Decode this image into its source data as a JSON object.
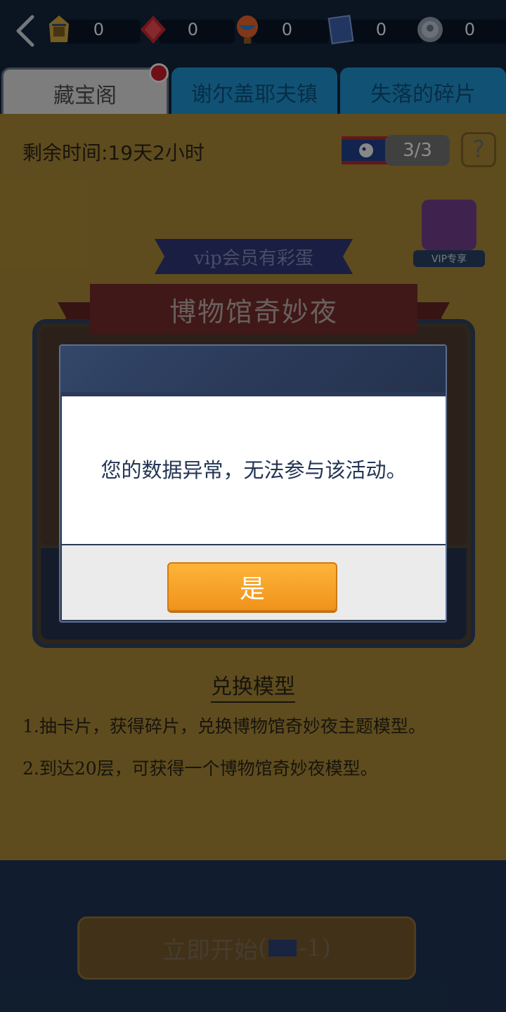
{
  "resources": [
    {
      "icon": "pharaoh-mask-icon",
      "value": "0"
    },
    {
      "icon": "red-gem-icon",
      "value": "0"
    },
    {
      "icon": "hot-air-balloon-icon",
      "value": "0"
    },
    {
      "icon": "blue-card-icon",
      "value": "0"
    },
    {
      "icon": "silver-coin-icon",
      "value": "0"
    }
  ],
  "tabs": [
    "藏宝阁",
    "谢尔盖耶夫镇",
    "失落的碎片"
  ],
  "timer": "剩余时间:19天2小时",
  "ticket_count": "3/3",
  "help_symbol": "?",
  "vip_label": "VIP专享",
  "vip_banner": "vip会员有彩蛋",
  "event_title": "博物馆奇妙夜",
  "section_title": "兑换模型",
  "rules": [
    "1.抽卡片，获得碎片，兑换博物馆奇妙夜主题模型。",
    "2.到达20层，可获得一个博物馆奇妙夜模型。"
  ],
  "start_button": {
    "label": "立即开始",
    "cost": "-1"
  },
  "dialog": {
    "message": "您的数据异常，无法参与该活动。",
    "confirm": "是"
  },
  "colors": {
    "panel": "#a38434",
    "tab_active": "#d8d8d8",
    "tab_inactive": "#1e8ec8",
    "confirm_button": "#f7a62a",
    "dialog_text": "#233553"
  }
}
